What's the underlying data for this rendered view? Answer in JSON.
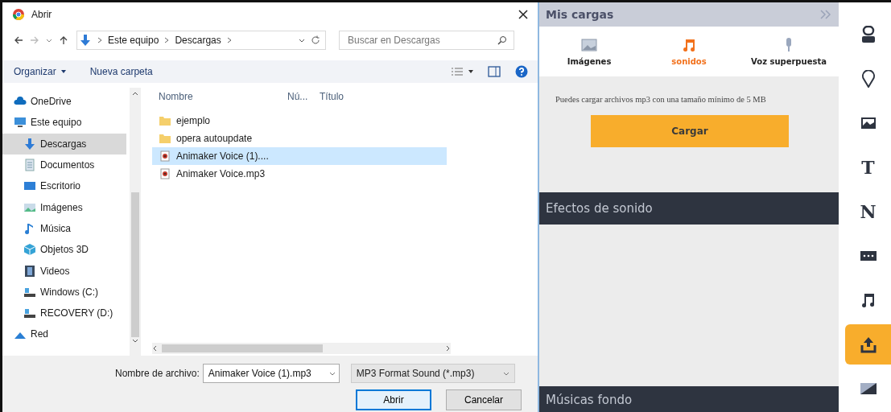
{
  "dialog": {
    "title": "Abrir",
    "address": {
      "path": [
        "Este equipo",
        "Descargas"
      ]
    },
    "search": {
      "placeholder": "Buscar en Descargas"
    },
    "toolbar": {
      "organize": "Organizar",
      "new_folder": "Nueva carpeta"
    },
    "nav": [
      {
        "label": "OneDrive",
        "kind": "cloud",
        "selected": false
      },
      {
        "label": "Este equipo",
        "kind": "computer",
        "selected": false
      },
      {
        "label": "Descargas",
        "kind": "download",
        "selected": true
      },
      {
        "label": "Documentos",
        "kind": "document",
        "selected": false
      },
      {
        "label": "Escritorio",
        "kind": "desktop",
        "selected": false
      },
      {
        "label": "Imágenes",
        "kind": "pictures",
        "selected": false
      },
      {
        "label": "Música",
        "kind": "music",
        "selected": false
      },
      {
        "label": "Objetos 3D",
        "kind": "cube",
        "selected": false
      },
      {
        "label": "Videos",
        "kind": "film",
        "selected": false
      },
      {
        "label": "Windows (C:)",
        "kind": "drive",
        "selected": false
      },
      {
        "label": "RECOVERY (D:)",
        "kind": "drive",
        "selected": false
      },
      {
        "label": "Red",
        "kind": "network",
        "selected": false
      }
    ],
    "columns": [
      "Nombre",
      "Nú...",
      "Título"
    ],
    "files": [
      {
        "name": "ejemplo",
        "kind": "folder",
        "selected": false
      },
      {
        "name": "opera autoupdate",
        "kind": "folder",
        "selected": false
      },
      {
        "name": "Animaker Voice (1)....",
        "kind": "audio",
        "selected": true
      },
      {
        "name": "Animaker Voice.mp3",
        "kind": "audio",
        "selected": false
      }
    ],
    "filename": {
      "label": "Nombre de archivo:",
      "value": "Animaker Voice (1).mp3"
    },
    "filetype": "MP3 Format Sound (*.mp3)",
    "buttons": [
      {
        "label": "Abrir",
        "primary": true
      },
      {
        "label": "Cancelar",
        "primary": false
      }
    ]
  },
  "panel": {
    "title": "Mis cargas",
    "tabs": [
      {
        "label": "Imágenes",
        "kind": "image",
        "selected": false
      },
      {
        "label": "sonidos",
        "kind": "music",
        "selected": true
      },
      {
        "label": "Voz superpuesta",
        "kind": "mic",
        "selected": false
      }
    ],
    "note": "Puedes cargar archivos mp3 con una tamaño mínimo de 5 MB",
    "upload_button": "Cargar",
    "sections": [
      "Efectos de sonido",
      "Músicas fondo"
    ]
  },
  "rail": [
    {
      "kind": "character",
      "selected": false
    },
    {
      "kind": "pin",
      "selected": false
    },
    {
      "kind": "image",
      "selected": false
    },
    {
      "kind": "letter",
      "label": "T",
      "selected": false
    },
    {
      "kind": "letter",
      "label": "N",
      "selected": false
    },
    {
      "kind": "video",
      "selected": false
    },
    {
      "kind": "music",
      "selected": false
    },
    {
      "kind": "upload",
      "selected": true
    },
    {
      "kind": "background",
      "selected": false
    }
  ]
}
